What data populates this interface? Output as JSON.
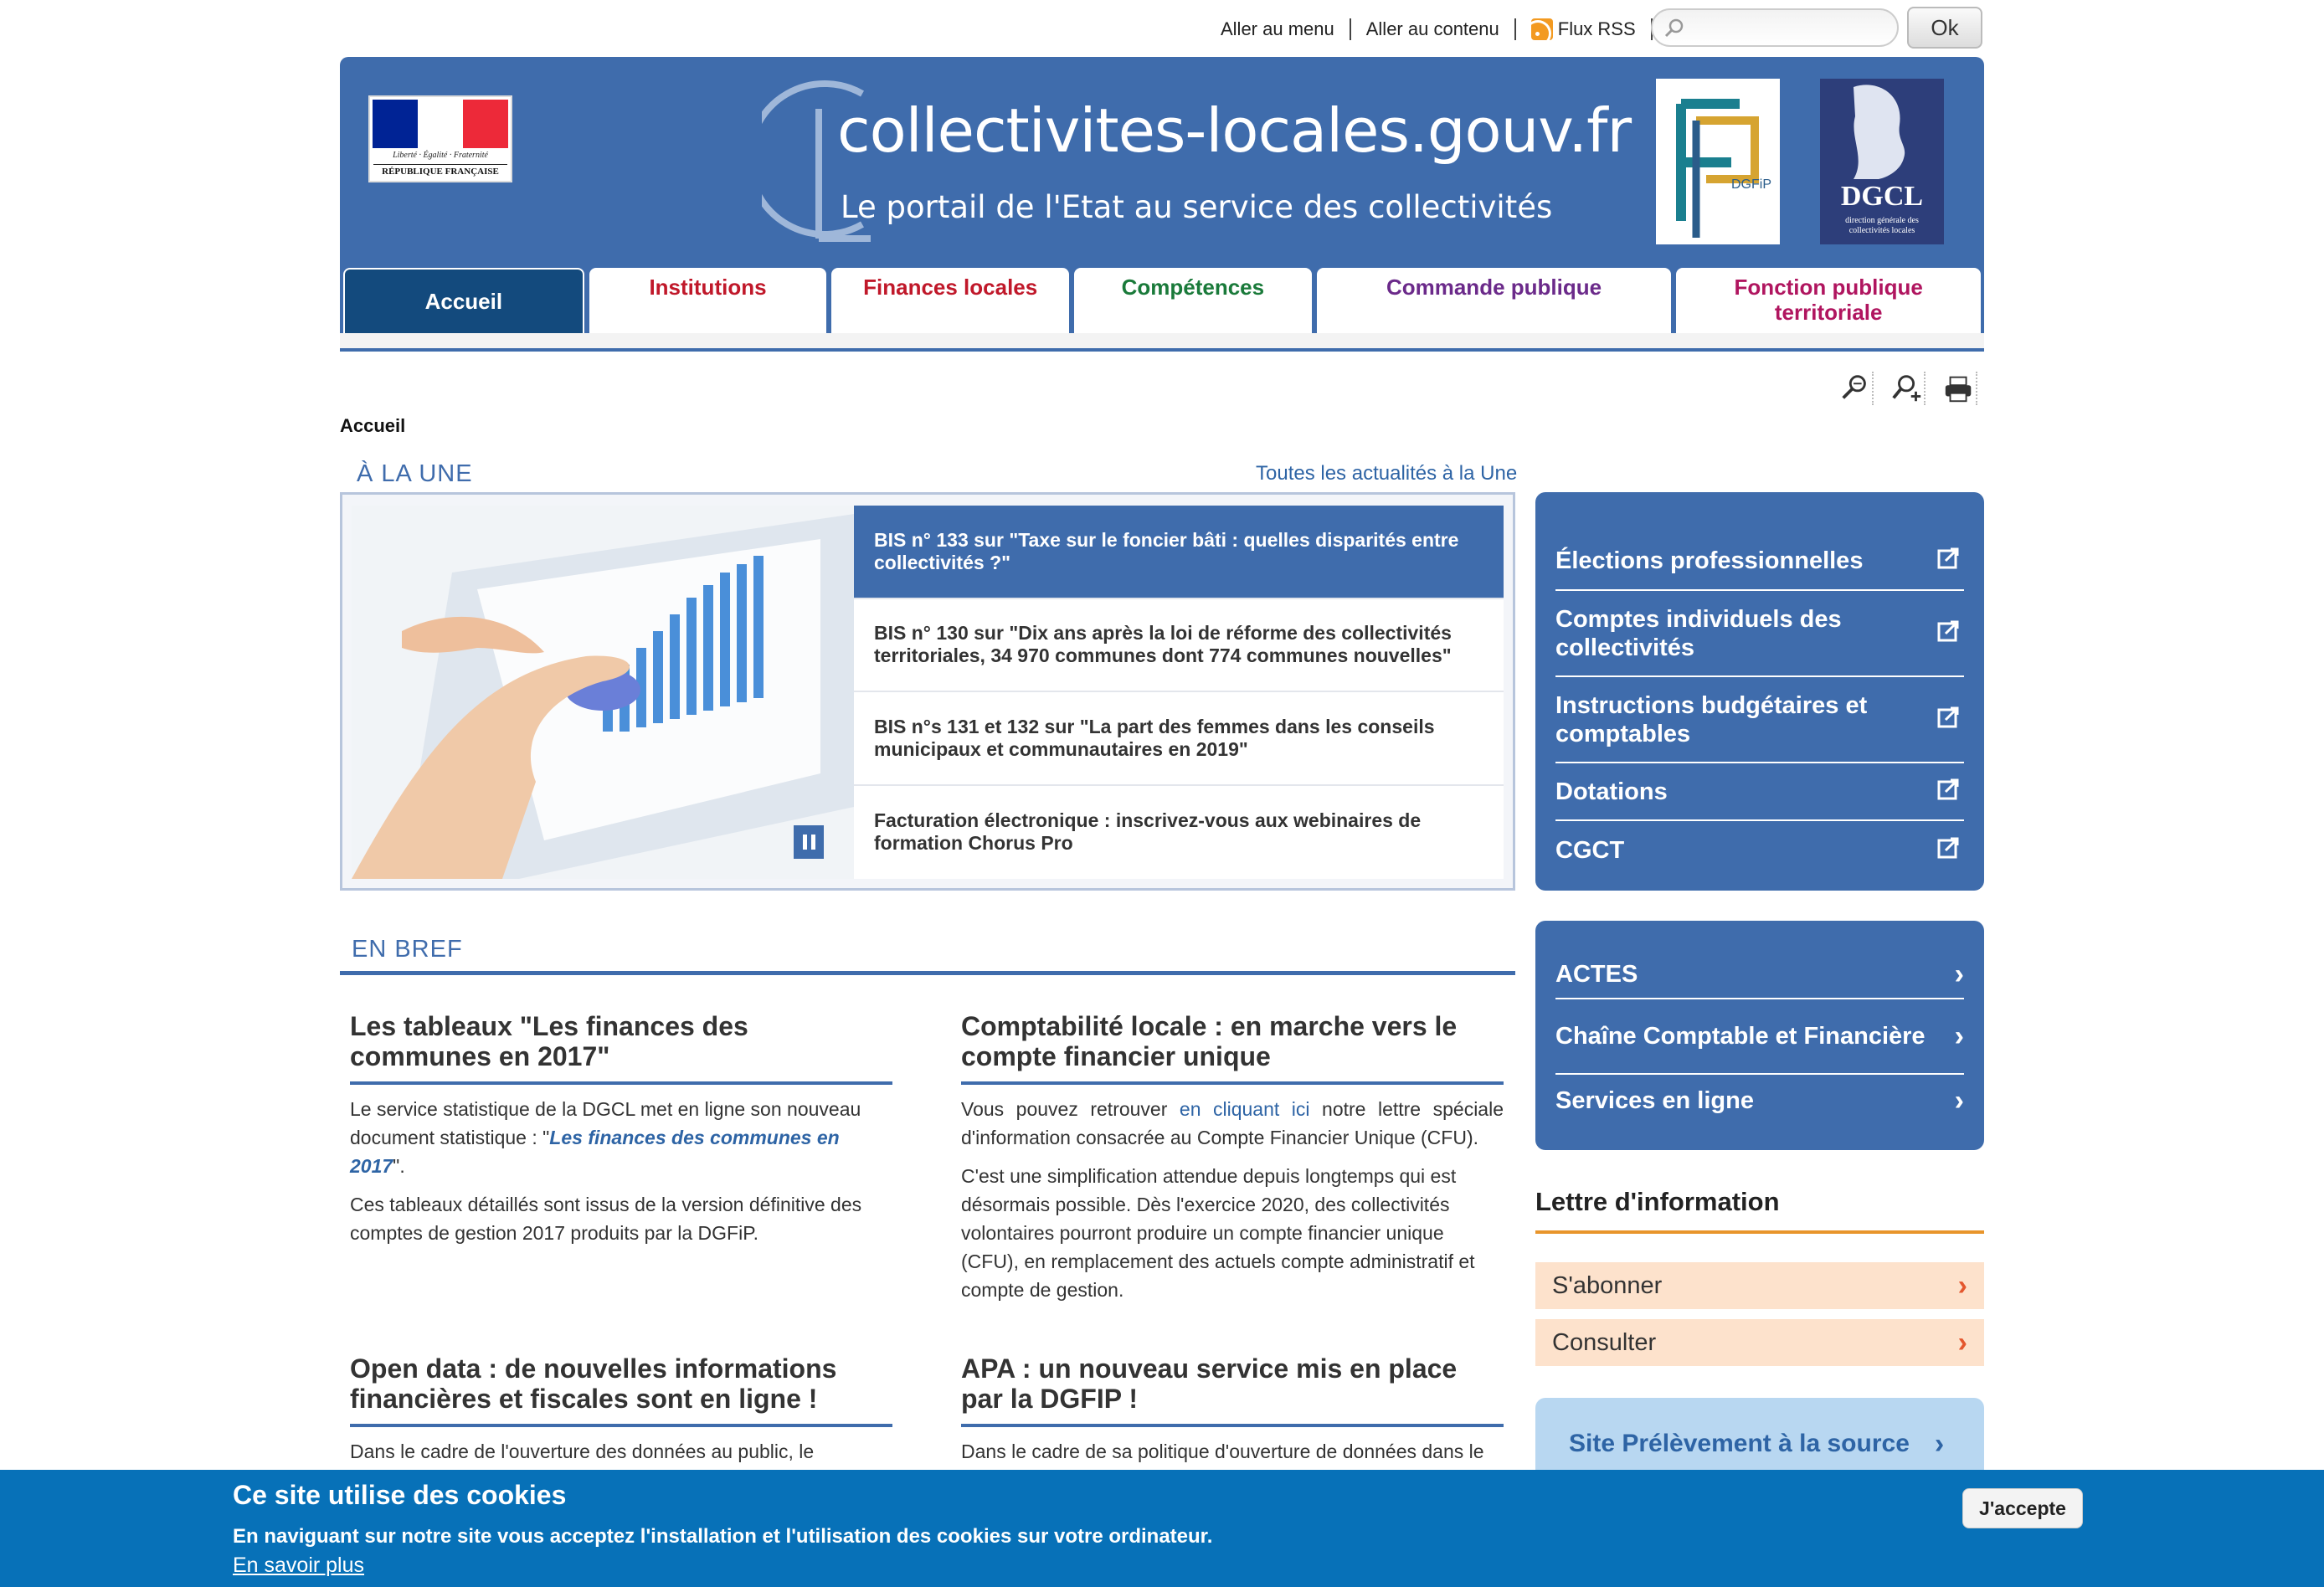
{
  "toplinks": {
    "menu": "Aller au menu",
    "contenu": "Aller au contenu",
    "rss": "Flux RSS"
  },
  "search": {
    "placeholder": "",
    "button": "Ok"
  },
  "header": {
    "site_title": "collectivites-locales.gouv.fr",
    "tagline": "Le portail de l'Etat au service des collectivités",
    "marianne_motto": "Liberté · Égalité · Fraternité",
    "marianne_rf": "RÉPUBLIQUE FRANÇAISE",
    "dgfip_label": "DGFiP",
    "dgcl_label": "DGCL",
    "dgcl_sub": "direction générale des collectivités locales",
    "flag_colors": [
      "#002395",
      "#ffffff",
      "#ed2939"
    ]
  },
  "nav": {
    "tabs": [
      {
        "label": "Accueil",
        "color": "#ffffff"
      },
      {
        "label": "Institutions",
        "color": "#c0182a"
      },
      {
        "label": "Finances locales",
        "color": "#c0182a"
      },
      {
        "label": "Compétences",
        "color": "#1a7a3a"
      },
      {
        "label": "Commande publique",
        "color": "#6b2a8a"
      },
      {
        "label": "Fonction publique territoriale",
        "color": "#b0155f"
      }
    ]
  },
  "tools": [
    "zoom-out-icon",
    "zoom-in-icon",
    "print-icon"
  ],
  "breadcrumb": "Accueil",
  "une": {
    "title": "À LA UNE",
    "all_link": "Toutes les actualités à la Une",
    "items": [
      "BIS n° 133 sur \"Taxe sur le foncier bâti : quelles disparités entre collectivités ?\"",
      "BIS n° 130 sur \"Dix ans après la loi de réforme des collectivités territoriales, 34 970 communes dont 774 communes nouvelles\"",
      "BIS n°s 131 et 132 sur \"La part des femmes dans les conseils municipaux et communautaires en 2019\"",
      "Facturation électronique : inscrivez-vous aux webinaires de formation Chorus Pro"
    ]
  },
  "bref": {
    "title": "EN BREF",
    "articles": [
      {
        "title": "Les tableaux \"Les finances des communes en 2017\"",
        "p1_a": "Le service statistique de la DGCL met en ligne son nouveau document statistique : \"",
        "p1_link": "Les finances des communes en 2017",
        "p1_b": "\".",
        "p2": "Ces tableaux détaillés sont issus de la version définitive des comptes de gestion 2017 produits par la DGFiP."
      },
      {
        "title": "Comptabilité locale : en marche vers le compte financier unique",
        "p1_a": "Vous pouvez retrouver ",
        "p1_link": "en cliquant ici",
        "p1_b": " notre lettre spéciale d'information consacrée au Compte Financier Unique (CFU).",
        "p2": "C'est une simplification attendue depuis longtemps qui est désormais possible. Dès l'exercice 2020, des collectivités volontaires pourront produire un compte financier unique (CFU), en remplacement des actuels compte administratif et compte de gestion."
      },
      {
        "title": "Open data : de nouvelles informations financières et fiscales sont en ligne !",
        "p1": "Dans le cadre de l'ouverture des données au public, le"
      },
      {
        "title": "APA : un nouveau service mis en place par la DGFIP !",
        "p1": "Dans le cadre de sa politique d'ouverture de données dans le"
      }
    ]
  },
  "side1": [
    "Élections professionnelles",
    "Comptes individuels des collectivités",
    "Instructions budgétaires et comptables",
    "Dotations",
    "CGCT"
  ],
  "side2": [
    "ACTES",
    "Chaîne Comptable et Financière",
    "Services en ligne"
  ],
  "lettre": {
    "title": "Lettre d'information",
    "subscribe": "S'abonner",
    "consult": "Consulter"
  },
  "pas": "Site Prélèvement à la source",
  "cookie": {
    "title": "Ce site utilise des cookies",
    "desc": "En naviguant sur notre site vous acceptez l'installation et l'utilisation des cookies sur votre ordinateur.",
    "more": "En savoir plus",
    "accept": "J'accepte"
  },
  "colors": {
    "brand_blue": "#3f6cac",
    "dark_blue": "#134a7d",
    "cookie_blue": "#0771b8",
    "orange": "#e8952b"
  }
}
